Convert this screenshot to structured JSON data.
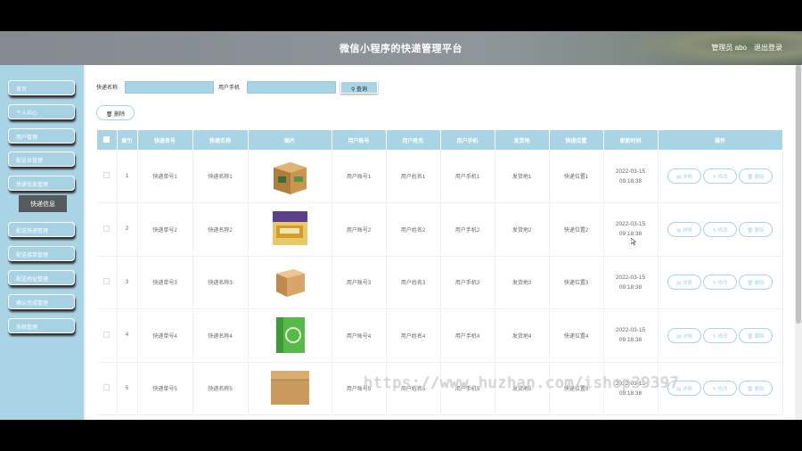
{
  "header": {
    "title": "微信小程序的快递管理平台",
    "user": "管理员 abo",
    "logout": "退出登录"
  },
  "sidebar": {
    "items": [
      {
        "label": "首页"
      },
      {
        "label": "个人中心"
      },
      {
        "label": "用户管理"
      },
      {
        "label": "配送员管理"
      },
      {
        "label": "快递信息管理"
      },
      {
        "label": "快递信息",
        "sub": true
      },
      {
        "label": "配送快递管理"
      },
      {
        "label": "配送接单管理"
      },
      {
        "label": "配送地址管理"
      },
      {
        "label": "确认完成管理"
      },
      {
        "label": "系统管理"
      }
    ]
  },
  "search": {
    "name_label": "快递名称",
    "phone_label": "用户手机",
    "query_label": "查询",
    "query_icon": "search-icon"
  },
  "toolbar": {
    "delete_label": "删除",
    "delete_icon": "trash-icon"
  },
  "table": {
    "columns": [
      "索引",
      "快递单号",
      "快递名称",
      "图片",
      "用户账号",
      "用户姓名",
      "用户手机",
      "发货地",
      "快递位置",
      "更新时间",
      "操作"
    ],
    "actions": {
      "detail": "详情",
      "edit": "修改",
      "delete": "删除"
    },
    "rows": [
      {
        "index": "1",
        "tracking": "快递单号1",
        "name": "快递名称1",
        "account": "用户账号1",
        "username": "用户姓名1",
        "phone": "用户手机1",
        "origin": "发货地1",
        "location": "快递位置1",
        "time": "2022-03-15 09:18:38",
        "image": "brown-carton-box"
      },
      {
        "index": "2",
        "tracking": "快递单号2",
        "name": "快递名称2",
        "account": "用户账号2",
        "username": "用户姓名2",
        "phone": "用户手机2",
        "origin": "发货地2",
        "location": "快递位置2",
        "time": "2022-03-15 09:18:38",
        "image": "printed-gift-box"
      },
      {
        "index": "3",
        "tracking": "快递单号3",
        "name": "快递名称3",
        "account": "用户账号3",
        "username": "用户姓名3",
        "phone": "用户手机3",
        "origin": "发货地3",
        "location": "快递位置3",
        "time": "2022-03-15 09:18:38",
        "image": "plain-kraft-box"
      },
      {
        "index": "4",
        "tracking": "快递单号4",
        "name": "快递名称4",
        "account": "用户账号4",
        "username": "用户姓名4",
        "phone": "用户手机4",
        "origin": "发货地4",
        "location": "快递位置4",
        "time": "2022-03-15 09:18:38",
        "image": "green-recycle-box"
      },
      {
        "index": "5",
        "tracking": "快递单号5",
        "name": "快递名称5",
        "account": "用户账号5",
        "username": "用户姓名5",
        "phone": "用户手机5",
        "origin": "发货地5",
        "location": "快递位置5",
        "time": "2022-03-15 09:18:38",
        "image": "flat-kraft-box"
      }
    ]
  },
  "watermark": "https://www.huzhan.com/ishop39397",
  "colors": {
    "accent": "#a9d4e6",
    "sidebar_sub": "#555a5c"
  }
}
